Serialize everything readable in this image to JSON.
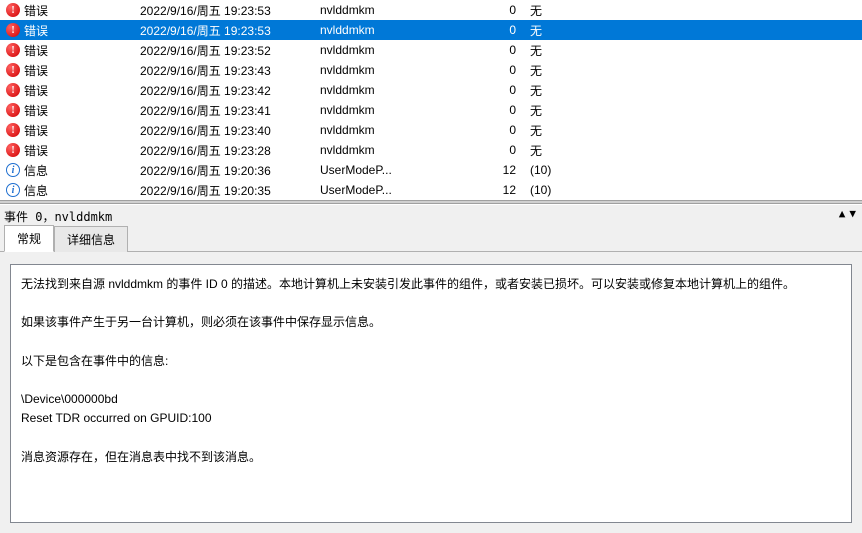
{
  "levels": {
    "error": "错误",
    "info": "信息"
  },
  "events": [
    {
      "level": "error",
      "date": "2022/9/16/周五 19:23:53",
      "source": "nvlddmkm",
      "id": 0,
      "task": "无",
      "selected": false
    },
    {
      "level": "error",
      "date": "2022/9/16/周五 19:23:53",
      "source": "nvlddmkm",
      "id": 0,
      "task": "无",
      "selected": true
    },
    {
      "level": "error",
      "date": "2022/9/16/周五 19:23:52",
      "source": "nvlddmkm",
      "id": 0,
      "task": "无",
      "selected": false
    },
    {
      "level": "error",
      "date": "2022/9/16/周五 19:23:43",
      "source": "nvlddmkm",
      "id": 0,
      "task": "无",
      "selected": false
    },
    {
      "level": "error",
      "date": "2022/9/16/周五 19:23:42",
      "source": "nvlddmkm",
      "id": 0,
      "task": "无",
      "selected": false
    },
    {
      "level": "error",
      "date": "2022/9/16/周五 19:23:41",
      "source": "nvlddmkm",
      "id": 0,
      "task": "无",
      "selected": false
    },
    {
      "level": "error",
      "date": "2022/9/16/周五 19:23:40",
      "source": "nvlddmkm",
      "id": 0,
      "task": "无",
      "selected": false
    },
    {
      "level": "error",
      "date": "2022/9/16/周五 19:23:28",
      "source": "nvlddmkm",
      "id": 0,
      "task": "无",
      "selected": false
    },
    {
      "level": "info",
      "date": "2022/9/16/周五 19:20:36",
      "source": "UserModeP...",
      "id": 12,
      "task": "(10)",
      "selected": false
    },
    {
      "level": "info",
      "date": "2022/9/16/周五 19:20:35",
      "source": "UserModeP...",
      "id": 12,
      "task": "(10)",
      "selected": false
    }
  ],
  "details": {
    "header": "事件 0，nvlddmkm",
    "tabs": {
      "general": "常规",
      "details": "详细信息"
    },
    "body": {
      "line1": "无法找到来自源 nvlddmkm 的事件 ID 0 的描述。本地计算机上未安装引发此事件的组件，或者安装已损坏。可以安装或修复本地计算机上的组件。",
      "line2": "如果该事件产生于另一台计算机，则必须在该事件中保存显示信息。",
      "line3": "以下是包含在事件中的信息: ",
      "line4": "\\Device\\000000bd",
      "line5": "Reset TDR occurred on GPUID:100",
      "line6": "消息资源存在，但在消息表中找不到该消息。"
    }
  }
}
